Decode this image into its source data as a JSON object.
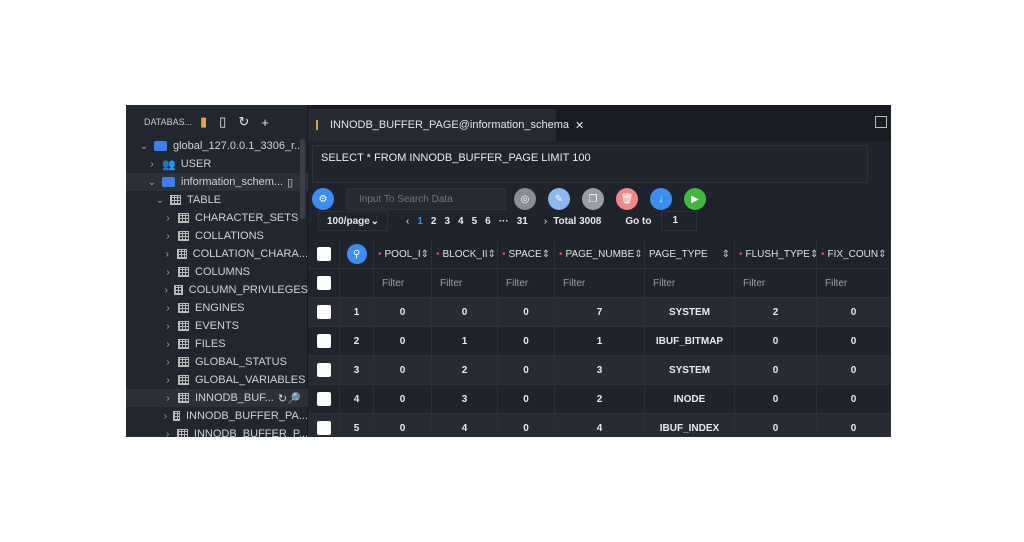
{
  "sidebar": {
    "title": "DATABAS...",
    "connection": "global_127.0.0.1_3306_r...",
    "user": "USER",
    "schema": "information_schem...",
    "table_group": "TABLE",
    "tables": [
      "CHARACTER_SETS",
      "COLLATIONS",
      "COLLATION_CHARA...",
      "COLUMNS",
      "COLUMN_PRIVILEGES",
      "ENGINES",
      "EVENTS",
      "FILES",
      "GLOBAL_STATUS",
      "GLOBAL_VARIABLES",
      "INNODB_BUF...",
      "INNODB_BUFFER_PA...",
      "INNODB_BUFFER_P..."
    ]
  },
  "tab": {
    "title": "INNODB_BUFFER_PAGE@information_schema",
    "close": "✕"
  },
  "query": "SELECT * FROM INNODB_BUFFER_PAGE LIMIT 100",
  "toolbar": {
    "search_placeholder": "Input To Search Data"
  },
  "pagination": {
    "page_size": "100/page",
    "pages": [
      "1",
      "2",
      "3",
      "4",
      "5",
      "6",
      "···",
      "31"
    ],
    "current": "1",
    "total": "Total 3008",
    "goto_label": "Go to",
    "goto_value": "1"
  },
  "table": {
    "columns": [
      "POOL_I",
      "BLOCK_II",
      "SPACE",
      "PAGE_NUMBE",
      "PAGE_TYPE",
      "FLUSH_TYPE",
      "FIX_COUN"
    ],
    "filter": "Filter",
    "rows": [
      [
        "1",
        "0",
        "0",
        "0",
        "7",
        "SYSTEM",
        "2",
        "0"
      ],
      [
        "2",
        "0",
        "1",
        "0",
        "1",
        "IBUF_BITMAP",
        "0",
        "0"
      ],
      [
        "3",
        "0",
        "2",
        "0",
        "3",
        "SYSTEM",
        "0",
        "0"
      ],
      [
        "4",
        "0",
        "3",
        "0",
        "2",
        "INODE",
        "0",
        "0"
      ],
      [
        "5",
        "0",
        "4",
        "0",
        "4",
        "IBUF_INDEX",
        "0",
        "0"
      ]
    ]
  },
  "colors": {
    "accent": "#3b8ff0",
    "bg": "#1f232b",
    "run": "#3fb93f",
    "delete": "#f08a8a"
  }
}
